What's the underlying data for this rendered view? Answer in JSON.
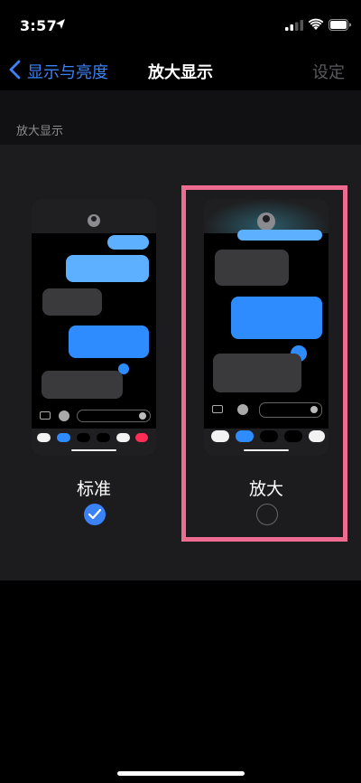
{
  "status_bar": {
    "time": "3:57"
  },
  "nav": {
    "back_label": "显示与亮度",
    "title": "放大显示",
    "action_label": "设定"
  },
  "section": {
    "header": "放大显示"
  },
  "options": [
    {
      "label": "标准",
      "selected": true
    },
    {
      "label": "放大",
      "selected": false
    }
  ],
  "colors": {
    "accent": "#3a82f6",
    "highlight": "#ee6c90",
    "group_bg": "#1c1c1e"
  }
}
